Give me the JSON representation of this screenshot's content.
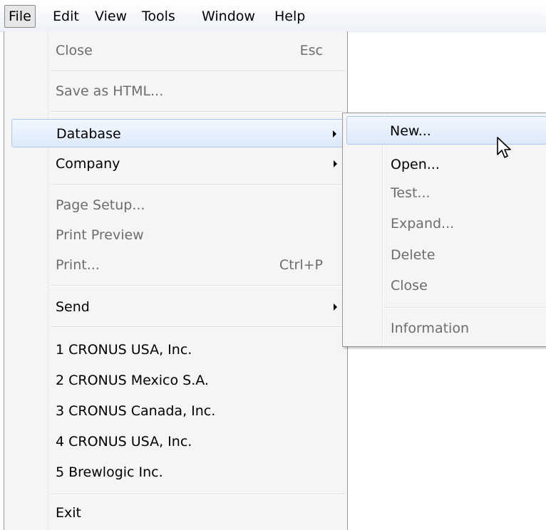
{
  "menubar": {
    "items": [
      "File",
      "Edit",
      "View",
      "Tools",
      "Window",
      "Help"
    ]
  },
  "file_menu": {
    "close": {
      "label": "Close",
      "shortcut": "Esc"
    },
    "save_html": {
      "label": "Save as HTML..."
    },
    "database": {
      "label": "Database"
    },
    "company": {
      "label": "Company"
    },
    "page_setup": {
      "label": "Page Setup..."
    },
    "print_preview": {
      "label": "Print Preview"
    },
    "print": {
      "label": "Print...",
      "shortcut": "Ctrl+P"
    },
    "send": {
      "label": "Send"
    },
    "recent": [
      "1 CRONUS USA, Inc.",
      "2 CRONUS Mexico S.A.",
      "3 CRONUS Canada, Inc.",
      "4 CRONUS USA, Inc.",
      "5 Brewlogic Inc."
    ],
    "exit": {
      "label": "Exit"
    }
  },
  "database_submenu": {
    "new": "New...",
    "open": "Open...",
    "test": "Test...",
    "expand": "Expand...",
    "delete": "Delete",
    "close": "Close",
    "information": "Information"
  },
  "colors": {
    "highlight_border": "#a8c8f0",
    "disabled_text": "#6d6d6d",
    "menu_bg": "#f5f5f5"
  },
  "icons": [
    "submenu-arrow-icon",
    "mouse-cursor-icon"
  ]
}
